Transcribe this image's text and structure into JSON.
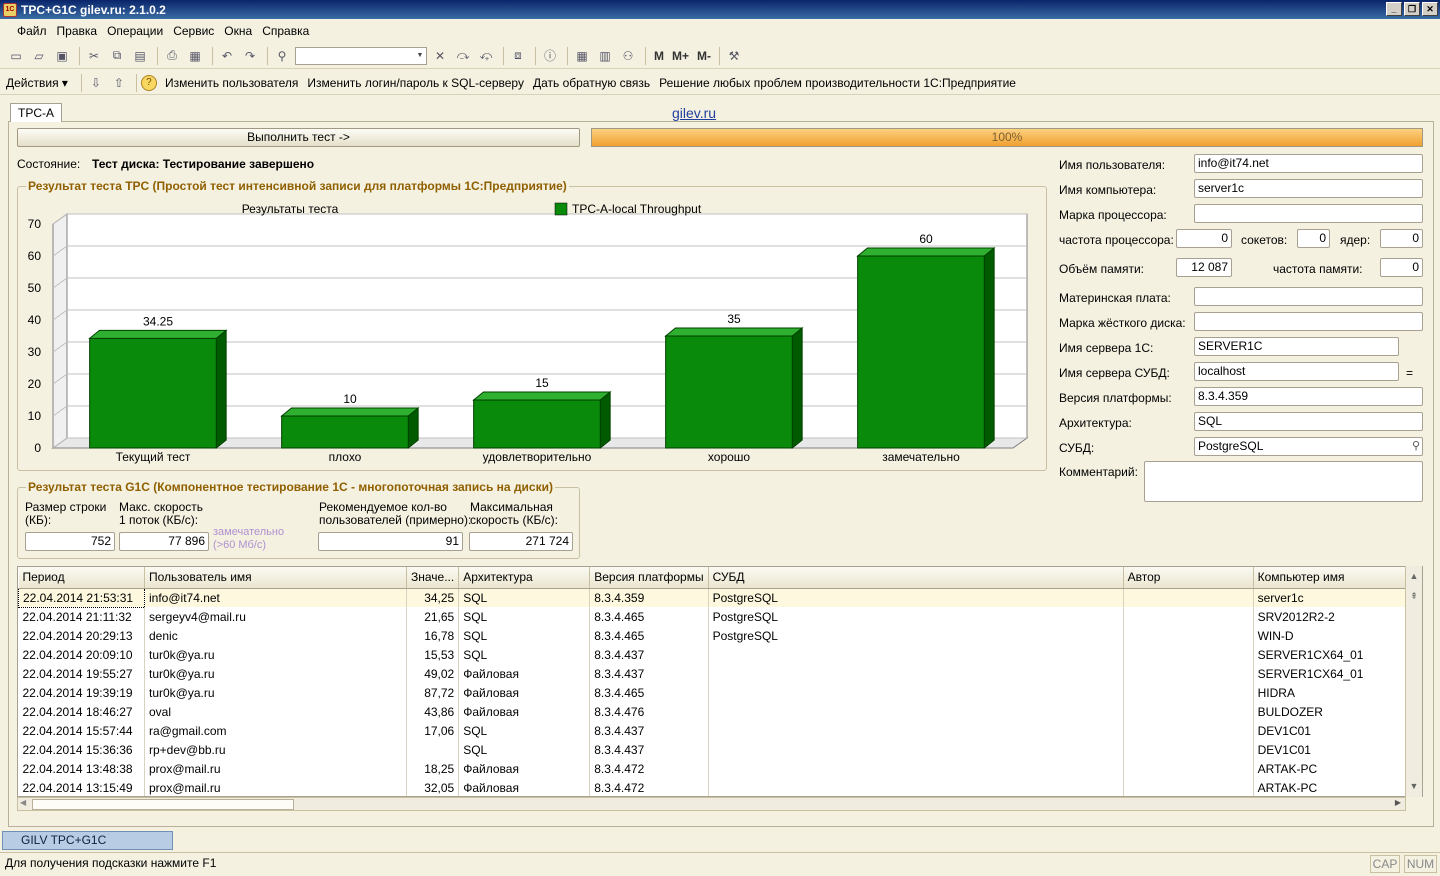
{
  "window": {
    "title": "TPC+G1C gilev.ru: 2.1.0.2",
    "icon": "1c-app-icon"
  },
  "menu": [
    "Файл",
    "Правка",
    "Операции",
    "Сервис",
    "Окна",
    "Справка"
  ],
  "actions": {
    "dropdown": "Действия",
    "items": [
      "Изменить пользователя",
      "Изменить логин/пароль к SQL-серверу",
      "Дать обратную связь",
      "Решение любых проблем производительности 1С:Предприятие"
    ]
  },
  "tab": "TPC-A",
  "link": "gilev.ru",
  "run_button": "Выполнить тест ->",
  "progress": {
    "label": "100%",
    "value": 1.0
  },
  "state": {
    "label": "Состояние:",
    "value": "Тест диска: Тестирование завершено"
  },
  "tpc_group_title": "Результат теста TPC (Простой тест интенсивной записи для платформы 1С:Предприятие)",
  "chart_data": {
    "type": "bar",
    "title": "Результаты теста",
    "legend": "TPC-A-local Throughput",
    "legend_position": "top",
    "categories": [
      "Текущий тест",
      "плохо",
      "удовлетворительно",
      "хорошо",
      "замечательно"
    ],
    "values": [
      34.25,
      10,
      15,
      35,
      60
    ],
    "value_labels": [
      "34.25",
      "10",
      "15",
      "35",
      "60"
    ],
    "yticks": [
      "0",
      "10",
      "20",
      "30",
      "40",
      "50",
      "60",
      "70"
    ],
    "ylim": [
      0,
      70
    ],
    "grid": true,
    "color": "#0a8a0a"
  },
  "g1c_group": {
    "title": "Результат теста G1C (Компонентное тестирование 1С - многопоточная запись на диски)",
    "row_size_label_1": "Размер строки",
    "row_size_label_2": "(КБ):",
    "row_size": "752",
    "max_speed_1_label_1": "Макс. скорость",
    "max_speed_1_label_2": "1 поток (КБ/с):",
    "max_speed_1": "77 896",
    "hint_1": "замечательно",
    "hint_2": "(>60 Мб/с)",
    "users_label_1": "Рекомендуемое кол-во",
    "users_label_2": "пользователей (примерно):",
    "users": "91",
    "max_speed_label_1": "Максимальная",
    "max_speed_label_2": "скорость (КБ/с):",
    "max_speed": "271 724"
  },
  "info": {
    "user_label": "Имя пользователя:",
    "user": "info@it74.net",
    "computer_label": "Имя компьютера:",
    "computer": "server1c",
    "cpu_brand_label": "Марка процессора:",
    "cpu_brand": "",
    "cpu_freq_label": "частота процессора:",
    "cpu_freq": "0",
    "sockets_label": "сокетов:",
    "sockets": "0",
    "cores_label": "ядер:",
    "cores": "0",
    "ram_label": "Объём памяти:",
    "ram": "12 087",
    "ram_freq_label": "частота памяти:",
    "ram_freq": "0",
    "mb_label": "Материнская плата:",
    "mb": "",
    "hdd_label": "Марка жёсткого диска:",
    "hdd": "",
    "server1c_label": "Имя сервера 1С:",
    "server1c": "SERVER1C",
    "dbserver_label": "Имя сервера СУБД:",
    "dbserver": "localhost",
    "dbserver_eq": "=",
    "platform_label": "Версия платформы:",
    "platform": "8.3.4.359",
    "arch_label": "Архитектура:",
    "arch": "SQL",
    "dbms_label": "СУБД:",
    "dbms": "PostgreSQL",
    "comment_label": "Комментарий:",
    "comment": ""
  },
  "table": {
    "columns": [
      "Период",
      "Пользователь имя",
      "Значе...",
      "Архитектура",
      "Версия платформы",
      "СУБД",
      "Автор",
      "Компьютер имя"
    ],
    "rows": [
      [
        "22.04.2014 21:53:31",
        "info@it74.net",
        "34,25",
        "SQL",
        "8.3.4.359",
        "PostgreSQL",
        "",
        "server1c"
      ],
      [
        "22.04.2014 21:11:32",
        "sergeyv4@mail.ru",
        "21,65",
        "SQL",
        "8.3.4.465",
        "PostgreSQL",
        "",
        "SRV2012R2-2"
      ],
      [
        "22.04.2014 20:29:13",
        "denic",
        "16,78",
        "SQL",
        "8.3.4.465",
        "PostgreSQL",
        "",
        "WIN-D"
      ],
      [
        "22.04.2014 20:09:10",
        "tur0k@ya.ru",
        "15,53",
        "SQL",
        "8.3.4.437",
        "",
        "",
        "SERVER1CX64_01"
      ],
      [
        "22.04.2014 19:55:27",
        "tur0k@ya.ru",
        "49,02",
        "Файловая",
        "8.3.4.437",
        "",
        "",
        "SERVER1CX64_01"
      ],
      [
        "22.04.2014 19:39:19",
        "tur0k@ya.ru",
        "87,72",
        "Файловая",
        "8.3.4.465",
        "",
        "",
        "HIDRA"
      ],
      [
        "22.04.2014 18:46:27",
        "oval",
        "43,86",
        "Файловая",
        "8.3.4.476",
        "",
        "",
        "BULDOZER"
      ],
      [
        "22.04.2014 15:57:44",
        "ra@gmail.com",
        "17,06",
        "SQL",
        "8.3.4.437",
        "",
        "",
        "DEV1C01"
      ],
      [
        "22.04.2014 15:36:36",
        "rp+dev@bb.ru",
        "",
        "SQL",
        "8.3.4.437",
        "",
        "",
        "DEV1C01"
      ],
      [
        "22.04.2014 13:48:38",
        "prox@mail.ru",
        "18,25",
        "Файловая",
        "8.3.4.472",
        "",
        "",
        "ARTAK-PC"
      ],
      [
        "22.04.2014 13:15:49",
        "prox@mail.ru",
        "32,05",
        "Файловая",
        "8.3.4.472",
        "",
        "",
        "ARTAK-PC"
      ]
    ]
  },
  "taskbar_item": "GILV TPC+G1C",
  "status": {
    "hint": "Для получения подсказки нажмите F1",
    "cap": "CAP",
    "num": "NUM"
  }
}
